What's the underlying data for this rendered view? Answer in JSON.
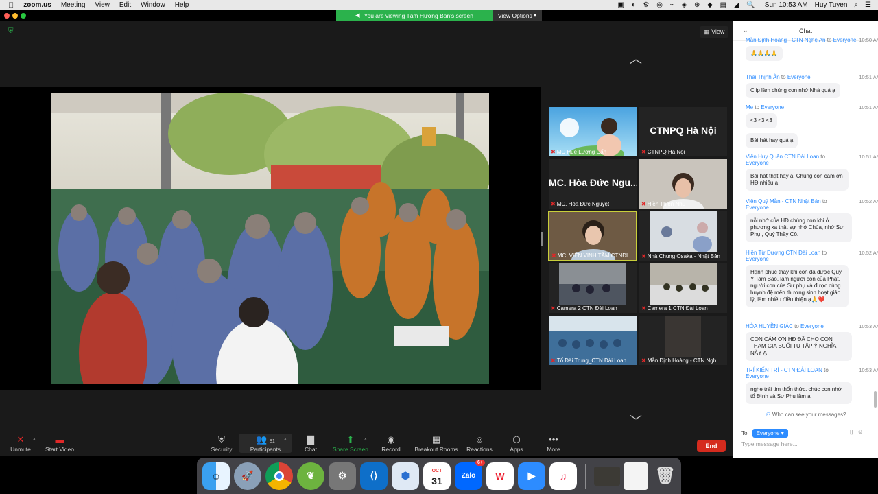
{
  "menubar": {
    "app": "zoom.us",
    "items": [
      "Meeting",
      "View",
      "Edit",
      "Window",
      "Help"
    ],
    "clock": "Sun 10:53 AM",
    "user": "Huy Tuyen"
  },
  "share": {
    "banner": "You are viewing Tâm Hương Bản's screen",
    "view_options": "View Options"
  },
  "view_label": "View",
  "tiles": [
    {
      "name": "MC Huệ Lương Cẩn",
      "big": ""
    },
    {
      "name": "CTNPQ Hà Nội",
      "big": "CTNPQ Hà Nội"
    },
    {
      "name": "MC. Hòa Đức Nguyệt",
      "big": "MC. Hòa Đức Ngu..."
    },
    {
      "name": "Hiền Thiện Nhu",
      "big": ""
    },
    {
      "name": "MC. VIÊN VINH TÂM CTNĐL",
      "big": ""
    },
    {
      "name": "Nhà Chung Osaka - Nhật Bản",
      "big": ""
    },
    {
      "name": "Camera 2 CTN Đài Loan",
      "big": ""
    },
    {
      "name": "Camera 1 CTN Đài Loan",
      "big": ""
    },
    {
      "name": "Tổ Đài Trung_CTN Đài Loan",
      "big": ""
    },
    {
      "name": "Mẫn Định Hoàng - CTN Ngh...",
      "big": ""
    }
  ],
  "toolbar": {
    "unmute": "Unmute",
    "start_video": "Start Video",
    "security": "Security",
    "participants": "Participants",
    "participants_count": "81",
    "chat": "Chat",
    "share_screen": "Share Screen",
    "record": "Record",
    "breakout": "Breakout Rooms",
    "reactions": "Reactions",
    "apps": "Apps",
    "more": "More",
    "end": "End"
  },
  "chat": {
    "title": "Chat",
    "messages": [
      {
        "from": "Mẫn Định Hoàng - CTN Nghệ An",
        "to_word": "to",
        "to": "Everyone",
        "time": "10:50 AM",
        "text": "🙏🙏🙏🙏"
      },
      {
        "from": "Thái Thịnh Ân",
        "to_word": "to",
        "to": "Everyone",
        "time": "10:51 AM",
        "text": "Clip làm chúng con nhớ Nhà quá ạ"
      },
      {
        "from": "Me",
        "to_word": "to",
        "to": "Everyone",
        "time": "10:51 AM",
        "text": "<3 <3 <3"
      },
      {
        "from": "",
        "to_word": "",
        "to": "",
        "time": "",
        "text": "Bài hát hay quá ạ"
      },
      {
        "from": "Viên Huy Quân CTN Đài Loan",
        "to_word": "to",
        "to": "Everyone",
        "time": "10:51 AM",
        "text": "Bài hát thật hay ạ. Chúng con cảm ơn HĐ nhiều ạ"
      },
      {
        "from": "Viên Quý Mẫn - CTN Nhật Bản",
        "to_word": "to",
        "to": "Everyone",
        "time": "10:52 AM",
        "text": "nỗi nhớ của HĐ chúng con khi ở phương xa thật sự nhớ Chùa, nhớ Sư Phụ , Quý Thầy Cô."
      },
      {
        "from": "Hiền Từ Dương CTN Đài Loan",
        "to_word": "to",
        "to": "Everyone",
        "time": "10:52 AM",
        "text": "Hạnh phúc thay khi con đã được Quy Y Tam Bảo, làm người con của Phật, người con của Sư phụ và được cùng huynh đệ mến thương sinh hoạt giáo lý, làm nhiều điều thiện ạ🙏❤️"
      },
      {
        "from": "HÒA HUYỀN GIÁC",
        "to_word": "to",
        "to": "Everyone",
        "time": "10:53 AM",
        "text": "CON CẢM ƠN HĐ ĐÃ CHO CON THAM GIA BUỔI TU TẬP Ý NGHĨA NÀY Ạ"
      },
      {
        "from": "TRÍ KIẾN TRÍ - CTN ĐÀI LOAN",
        "to_word": "to",
        "to": "Everyone",
        "time": "10:53 AM",
        "text": "nghe trái tim thổn thức. chúc con nhớ tổ Đình và Sư Phụ lắm ạ"
      }
    ],
    "who_see": "Who can see your messages?",
    "to_label": "To:",
    "to_value": "Everyone",
    "input_placeholder": "Type message here..."
  },
  "dock": {
    "calendar_month": "OCT",
    "calendar_day": "31",
    "zalo_badge": "6+"
  }
}
